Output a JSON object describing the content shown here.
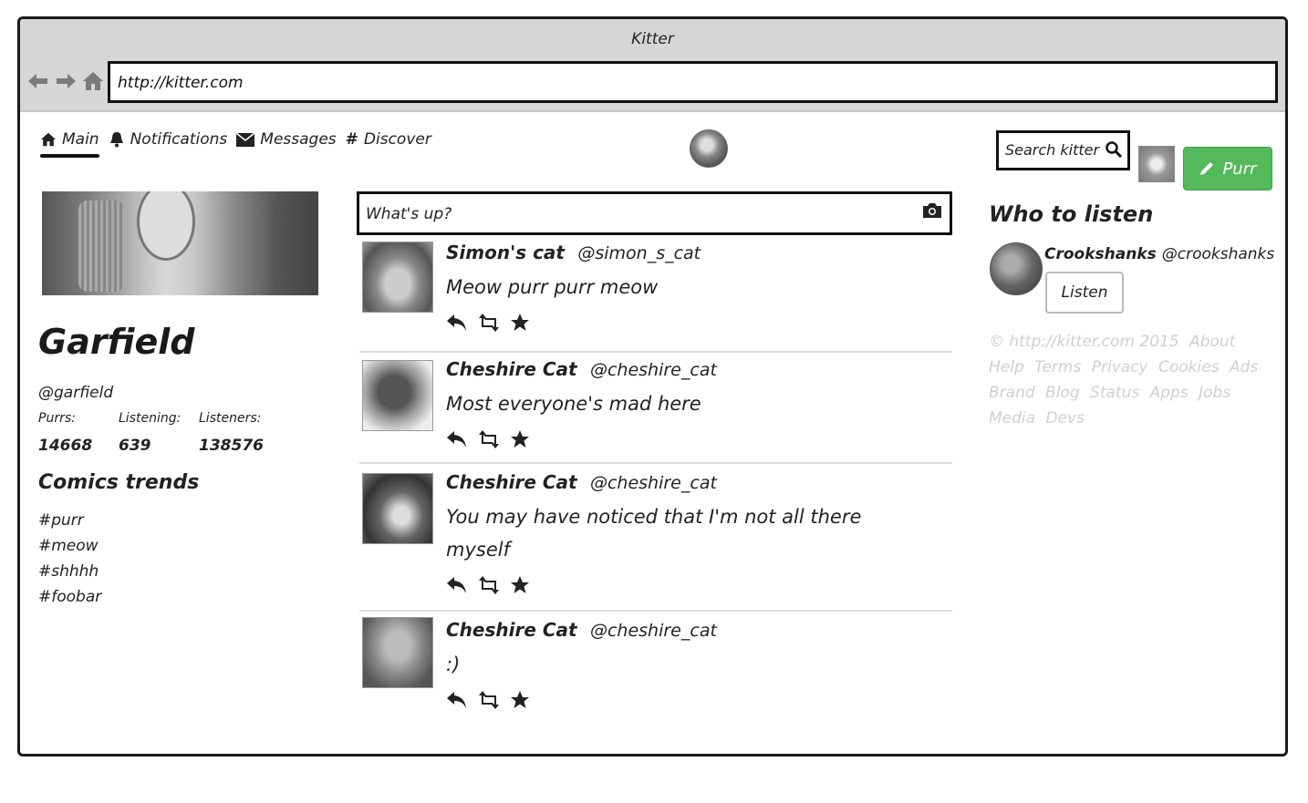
{
  "window": {
    "title": "Kitter"
  },
  "browser": {
    "url": "http://kitter.com"
  },
  "nav": {
    "items": [
      {
        "label": "Main",
        "icon": "home-icon"
      },
      {
        "label": "Notifications",
        "icon": "bell-icon"
      },
      {
        "label": "Messages",
        "icon": "envelope-icon"
      },
      {
        "label": "Discover",
        "icon": "hash-icon"
      }
    ]
  },
  "search": {
    "placeholder": "Search kitter"
  },
  "compose": {
    "placeholder": "What's up?",
    "purr_label": "Purr"
  },
  "profile": {
    "name": "Garfield",
    "handle": "@garfield",
    "stats": [
      {
        "label": "Purrs:",
        "value": "14668"
      },
      {
        "label": "Listening:",
        "value": "639"
      },
      {
        "label": "Listeners:",
        "value": "138576"
      }
    ]
  },
  "trends": {
    "title": "Comics trends",
    "items": [
      "#purr",
      "#meow",
      "#shhhh",
      "#foobar"
    ]
  },
  "feed": [
    {
      "name": "Simon's cat",
      "handle": "@simon_s_cat",
      "text": "Meow purr purr meow"
    },
    {
      "name": "Cheshire Cat",
      "handle": "@cheshire_cat",
      "text": "Most everyone's mad here"
    },
    {
      "name": "Cheshire Cat",
      "handle": "@cheshire_cat",
      "text": "You may have noticed that I'm not all there myself"
    },
    {
      "name": "Cheshire Cat",
      "handle": "@cheshire_cat",
      "text": ":)"
    }
  ],
  "who_to_listen": {
    "title": "Who to listen",
    "name": "Crookshanks",
    "handle": "@crookshanks",
    "button": "Listen"
  },
  "footer": {
    "links": [
      "© http://kitter.com 2015",
      "About",
      "Help",
      "Terms",
      "Privacy",
      "Cookies",
      "Ads",
      "Brand",
      "Blog",
      "Status",
      "Apps",
      "Jobs",
      "Media",
      "Devs"
    ]
  },
  "colors": {
    "purr_button": "#53b95a",
    "footer_text": "#cfcfcf"
  }
}
